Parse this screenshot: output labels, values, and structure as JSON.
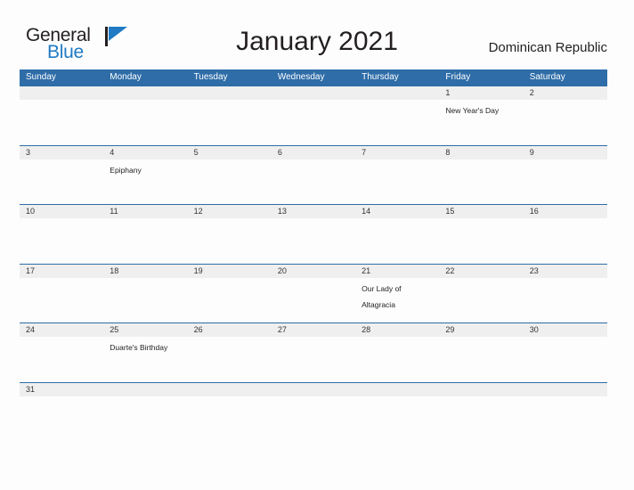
{
  "brand": {
    "name_part1": "General",
    "name_part2": "Blue",
    "flag_icon": "flag-icon",
    "flag_color": "#1f7bc4"
  },
  "header": {
    "title": "January 2021",
    "country": "Dominican Republic"
  },
  "theme": {
    "header_blue": "#2e6da8",
    "band_gray": "#efefef",
    "page_background": "#fdfdfd",
    "text": "#231f20"
  },
  "calendar": {
    "weekdays": [
      "Sunday",
      "Monday",
      "Tuesday",
      "Wednesday",
      "Thursday",
      "Friday",
      "Saturday"
    ],
    "weeks": [
      {
        "days": [
          {
            "number": "",
            "event": ""
          },
          {
            "number": "",
            "event": ""
          },
          {
            "number": "",
            "event": ""
          },
          {
            "number": "",
            "event": ""
          },
          {
            "number": "",
            "event": ""
          },
          {
            "number": "1",
            "event": "New Year's Day"
          },
          {
            "number": "2",
            "event": ""
          }
        ]
      },
      {
        "days": [
          {
            "number": "3",
            "event": ""
          },
          {
            "number": "4",
            "event": "Epiphany"
          },
          {
            "number": "5",
            "event": ""
          },
          {
            "number": "6",
            "event": ""
          },
          {
            "number": "7",
            "event": ""
          },
          {
            "number": "8",
            "event": ""
          },
          {
            "number": "9",
            "event": ""
          }
        ]
      },
      {
        "days": [
          {
            "number": "10",
            "event": ""
          },
          {
            "number": "11",
            "event": ""
          },
          {
            "number": "12",
            "event": ""
          },
          {
            "number": "13",
            "event": ""
          },
          {
            "number": "14",
            "event": ""
          },
          {
            "number": "15",
            "event": ""
          },
          {
            "number": "16",
            "event": ""
          }
        ]
      },
      {
        "days": [
          {
            "number": "17",
            "event": ""
          },
          {
            "number": "18",
            "event": ""
          },
          {
            "number": "19",
            "event": ""
          },
          {
            "number": "20",
            "event": ""
          },
          {
            "number": "21",
            "event": "Our Lady of Altagracia"
          },
          {
            "number": "22",
            "event": ""
          },
          {
            "number": "23",
            "event": ""
          }
        ]
      },
      {
        "days": [
          {
            "number": "24",
            "event": ""
          },
          {
            "number": "25",
            "event": "Duarte's Birthday"
          },
          {
            "number": "26",
            "event": ""
          },
          {
            "number": "27",
            "event": ""
          },
          {
            "number": "28",
            "event": ""
          },
          {
            "number": "29",
            "event": ""
          },
          {
            "number": "30",
            "event": ""
          }
        ]
      },
      {
        "days": [
          {
            "number": "31",
            "event": ""
          },
          {
            "number": "",
            "event": ""
          },
          {
            "number": "",
            "event": ""
          },
          {
            "number": "",
            "event": ""
          },
          {
            "number": "",
            "event": ""
          },
          {
            "number": "",
            "event": ""
          },
          {
            "number": "",
            "event": ""
          }
        ]
      }
    ]
  }
}
